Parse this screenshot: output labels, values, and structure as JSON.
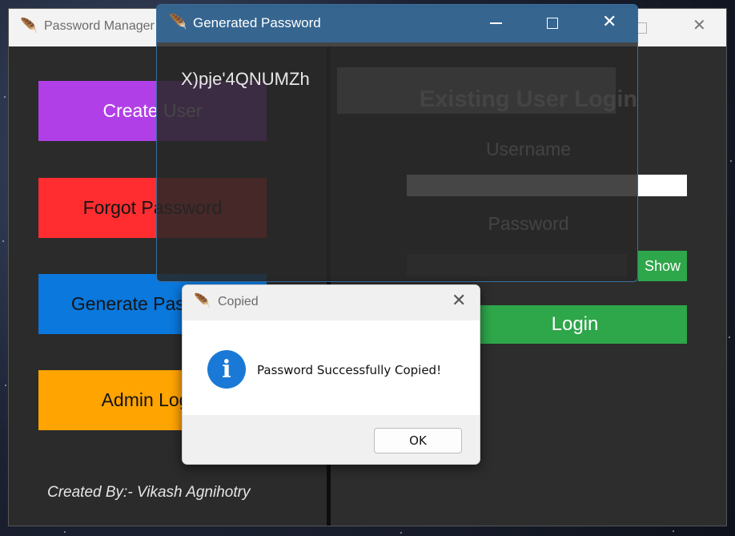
{
  "main_window": {
    "title": "Password Manager 1.0",
    "left_buttons": {
      "create_user": "Create User",
      "forgot_password": "Forgot Password",
      "generate_password": "Generate Password",
      "admin_login": "Admin Login"
    },
    "credit": "Created By:- Vikash Agnihotry",
    "login_panel": {
      "heading": "Existing User Login",
      "username_label": "Username",
      "username_value": "",
      "password_label": "Password",
      "password_value": "",
      "show_label": "Show",
      "login_label": "Login"
    }
  },
  "generated_window": {
    "title": "Generated Password",
    "password": "X)pje'4QNUMZh"
  },
  "dialog": {
    "title": "Copied",
    "icon": "info-icon",
    "icon_glyph": "i",
    "message": "Password Successfully Copied!",
    "ok_label": "OK"
  },
  "colors": {
    "create_user": "#b13fe8",
    "forgot_password": "#ff2d30",
    "generate_password": "#0a78dc",
    "admin_login": "#ffa400",
    "login_green": "#2ea64a",
    "titlebar_blue": "#356895"
  }
}
